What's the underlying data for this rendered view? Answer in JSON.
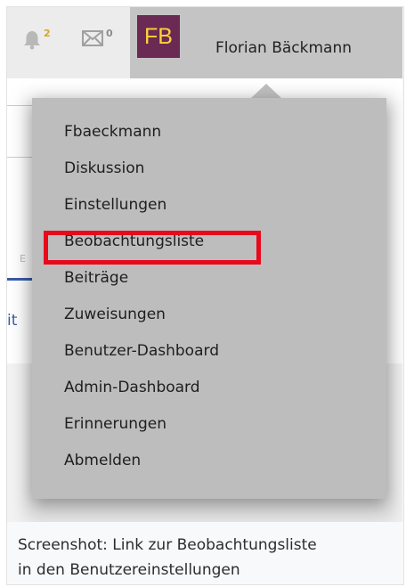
{
  "header": {
    "notifications_count": "2",
    "messages_count": "0",
    "avatar_initials": "FB",
    "user_name": "Florian Bäckmann"
  },
  "page": {
    "partial_tab_letter": "E",
    "partial_link": "it"
  },
  "menu": {
    "items": [
      {
        "label": "Fbaeckmann"
      },
      {
        "label": "Diskussion"
      },
      {
        "label": "Einstellungen"
      },
      {
        "label": "Beobachtungsliste",
        "highlighted": true
      },
      {
        "label": "Beiträge"
      },
      {
        "label": "Zuweisungen"
      },
      {
        "label": "Benutzer-Dashboard"
      },
      {
        "label": "Admin-Dashboard"
      },
      {
        "label": "Erinnerungen"
      },
      {
        "label": "Abmelden"
      }
    ]
  },
  "caption": {
    "line1": "Screenshot: Link zur Beobachtungsliste",
    "line2": "in den Benutzereinstellungen"
  },
  "colors": {
    "avatar_bg": "#6a2a54",
    "avatar_text": "#ffd23a",
    "highlight_border": "#e8091c",
    "menu_bg": "#bdbdbd",
    "notif_count": "#d8a623"
  },
  "icons": [
    "bell-icon",
    "mail-icon"
  ]
}
